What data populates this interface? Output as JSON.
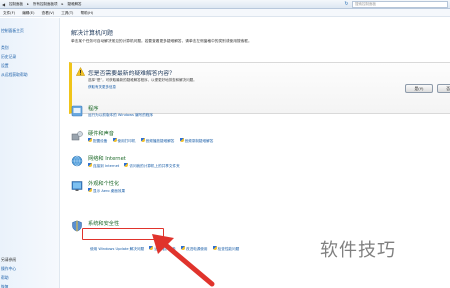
{
  "address": {
    "crumbs": [
      "控制面板",
      "所有控制面板项",
      "疑难解答"
    ],
    "search_placeholder": "搜索控制面板"
  },
  "menu": [
    "文件(F)",
    "编辑(E)",
    "查看(V)",
    "工具(T)",
    "帮助(H)"
  ],
  "left": {
    "home": "控制面板主页",
    "categories": "类别",
    "history": "历史记录",
    "settings": "设置",
    "remote": "从远程获取帮助",
    "see_also": "另请参阅",
    "center": "操作中心",
    "help": "帮助",
    "recovery": "恢复"
  },
  "main": {
    "title": "解决计算机问题",
    "desc": "单击某个任务可自动解决常见的计算机问题。若要查看更多疑难解答，请单击左侧窗格中的类别或使用搜索框。",
    "banner": {
      "title": "您是否需要最新的疑难解答内容？",
      "desc": "选择“是”，可获取最新的疑难解答程序，以便更好地排查和解决问题。",
      "link": "获取有关更多信息",
      "yes": "是(Y)",
      "no": "否(N)"
    },
    "categories": [
      {
        "title": "程序",
        "links": [
          "运行为以前版本的 Windows 编写的程序"
        ]
      },
      {
        "title": "硬件和声音",
        "links": [
          "配置设备",
          "使用打印机",
          "音频播放疑难解答",
          "音频录制疑难解答"
        ]
      },
      {
        "title": "网络和 Internet",
        "links": [
          "连接到 Internet",
          "访问我的计算机上的共享文件夹"
        ]
      },
      {
        "title": "外观和个性化",
        "links": [
          "显示 Aero 桌面效果"
        ]
      },
      {
        "title": "系统和安全性",
        "links": [
          "使用 Windows Update 解决问题",
          "运行维护任务",
          "改进电源使用",
          "检查性能问题"
        ]
      }
    ]
  },
  "watermark": "软件技巧",
  "colors": {
    "highlight": "#e0332c",
    "link": "#1a5ea8",
    "category_title": "#1f6b2b"
  }
}
